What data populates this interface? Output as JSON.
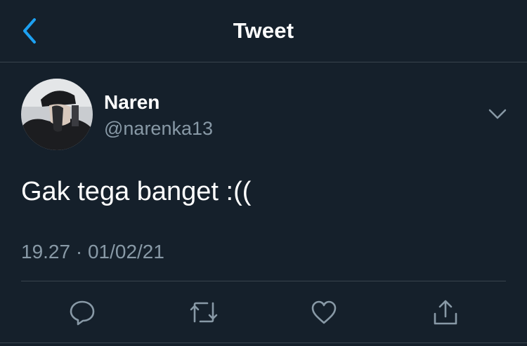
{
  "header": {
    "title": "Tweet",
    "back_icon": "chevron-left-icon",
    "accent": "#1da1f2"
  },
  "tweet": {
    "author": {
      "name": "Naren",
      "handle": "@narenka13"
    },
    "text": "Gak tega banget :((",
    "timestamp": "19.27 · 01/02/21",
    "menu_icon": "chevron-down-icon"
  },
  "actions": [
    {
      "name": "reply",
      "icon": "reply-icon"
    },
    {
      "name": "retweet",
      "icon": "retweet-icon"
    },
    {
      "name": "like",
      "icon": "heart-icon"
    },
    {
      "name": "share",
      "icon": "share-icon"
    }
  ],
  "colors": {
    "background": "#15202b",
    "secondary_text": "#8899a6",
    "divider": "#38444d"
  }
}
